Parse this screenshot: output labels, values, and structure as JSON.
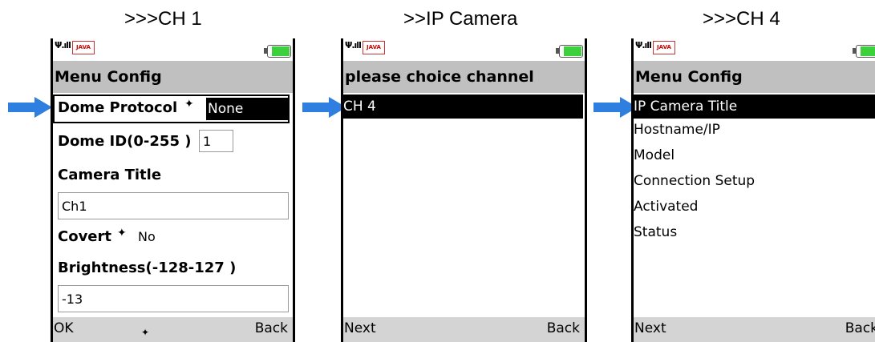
{
  "captions": [
    ">>>CH 1",
    ">>IP Camera",
    ">>>CH 4"
  ],
  "status": {
    "signal_icon": "signal-icon",
    "java_label": "JAVA",
    "battery_icon": "battery-icon"
  },
  "screen1": {
    "title": "Menu Config",
    "dome_protocol_label": "Dome Protocol",
    "dome_protocol_value": "None",
    "dome_id_label": "Dome ID(0-255 )",
    "dome_id_value": "1",
    "camera_title_label": "Camera Title",
    "camera_title_value": "Ch1",
    "covert_label": "Covert",
    "covert_value": "No",
    "brightness_label": "Brightness(-128-127 )",
    "brightness_value": "-13",
    "left_softkey": "OK",
    "right_softkey": "Back"
  },
  "screen2": {
    "title": "please choice channel",
    "items": [
      "CH 4"
    ],
    "left_softkey": "Next",
    "right_softkey": "Back"
  },
  "screen3": {
    "title": "Menu Config",
    "items": [
      "IP Camera Title",
      "Hostname/IP",
      "Model",
      "Connection Setup",
      "Activated",
      "Status"
    ],
    "left_softkey": "Next",
    "right_softkey": "Back"
  },
  "colors": {
    "arrow": "#2f7fe0",
    "selection": "#000000",
    "titlebar": "#c0c0c0",
    "battery": "#3cd13c"
  }
}
